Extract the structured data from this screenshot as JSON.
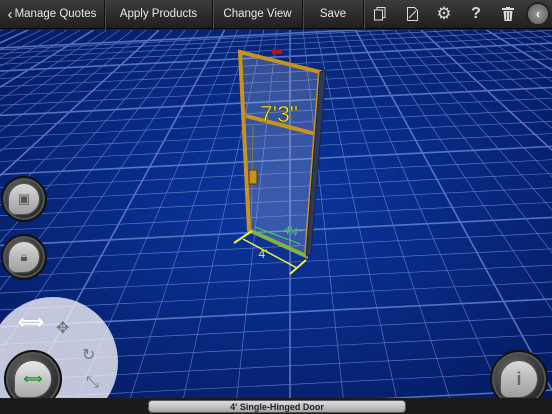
{
  "toolbar": {
    "back_label": "Manage Quotes",
    "apply_label": "Apply Products",
    "view_label": "Change View",
    "save_label": "Save",
    "back_chevron": "‹",
    "collapse_chevron": "‹"
  },
  "scene": {
    "height_dim": "7'3\"",
    "width_dim": "4'",
    "depth_dim": "4'4\""
  },
  "status": {
    "object_name": "4'  Single-Hinged Door"
  },
  "colors": {
    "grid_bg": "#06237a",
    "grid_line": "#6f8fd8",
    "frame": "#c9921c",
    "dimension": "#f2ef3a",
    "accent": "#3dd55a"
  },
  "icons": [
    "chevron-left-icon",
    "copy-icon",
    "page-icon",
    "gear-icon",
    "help-icon",
    "trash-icon",
    "camera-icon",
    "lock-icon",
    "move-arrows-icon",
    "pan-icon",
    "rotate-icon",
    "scale-icon",
    "info-icon"
  ]
}
